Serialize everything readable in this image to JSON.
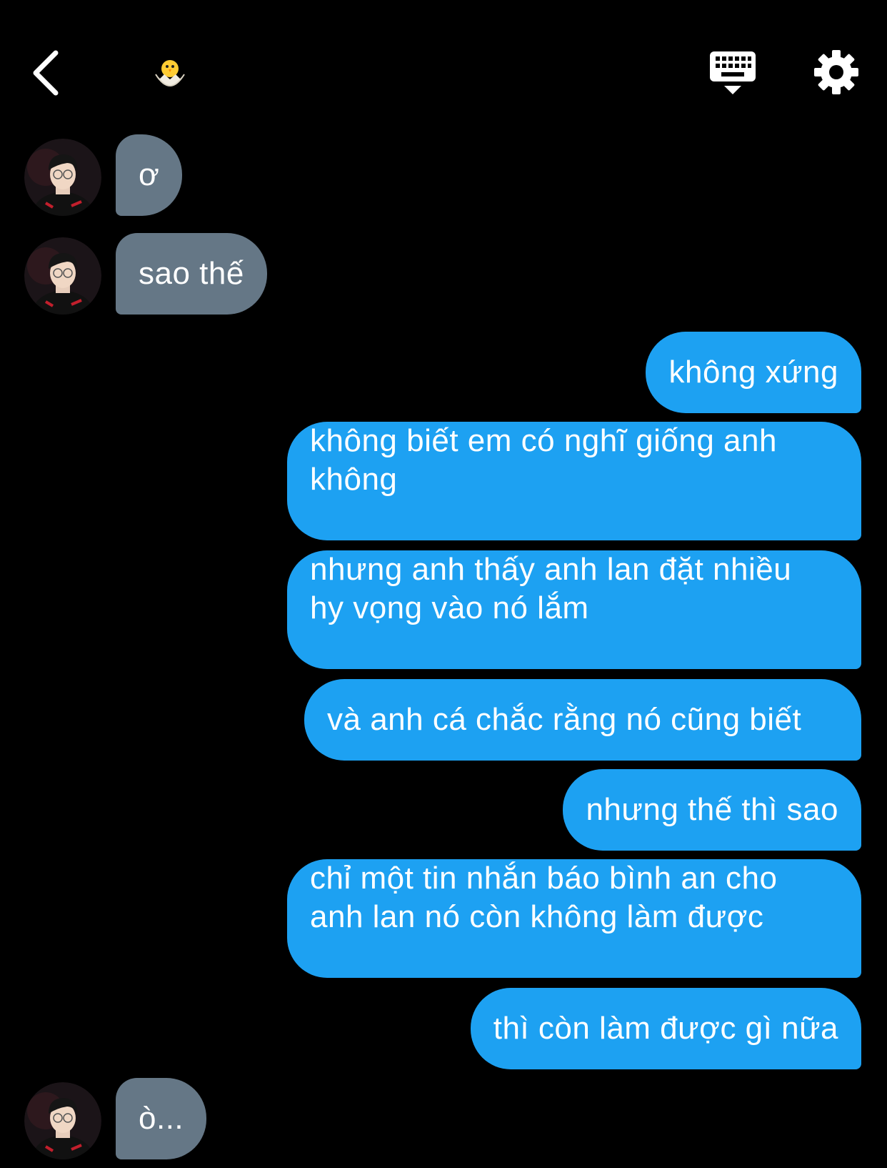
{
  "header": {
    "back_icon": "chevron-left-icon",
    "profile_icon": "hatching-chick-icon",
    "keyboard_icon": "keyboard-hide-icon",
    "settings_icon": "gear-icon"
  },
  "colors": {
    "background": "#000000",
    "incoming_bubble": "#657786",
    "outgoing_bubble": "#1da1f2",
    "text": "#ffffff"
  },
  "messages": [
    {
      "direction": "incoming",
      "lines": [
        "ơ"
      ]
    },
    {
      "direction": "incoming",
      "lines": [
        "sao thế"
      ]
    },
    {
      "direction": "outgoing",
      "lines": [
        "không xứng"
      ]
    },
    {
      "direction": "outgoing",
      "lines": [
        "không biết em có nghĩ giống anh",
        "không"
      ]
    },
    {
      "direction": "outgoing",
      "lines": [
        "nhưng anh thấy anh lan đặt nhiều",
        "hy vọng vào nó lắm"
      ]
    },
    {
      "direction": "outgoing",
      "lines": [
        "và anh cá chắc rằng nó cũng biết"
      ]
    },
    {
      "direction": "outgoing",
      "lines": [
        "nhưng thế thì sao"
      ]
    },
    {
      "direction": "outgoing",
      "lines": [
        "chỉ một tin nhắn báo bình an cho",
        "anh lan nó còn không làm được"
      ]
    },
    {
      "direction": "outgoing",
      "lines": [
        "thì còn làm được gì nữa"
      ]
    },
    {
      "direction": "incoming",
      "lines": [
        "ò..."
      ]
    }
  ]
}
